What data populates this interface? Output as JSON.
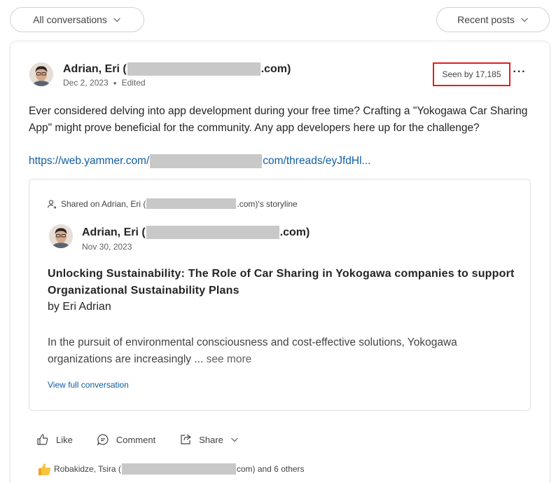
{
  "filters": {
    "left_label": "All conversations",
    "right_label": "Recent posts"
  },
  "post": {
    "author_prefix": "Adrian, Eri (",
    "author_suffix": ".com)",
    "date": "Dec 2, 2023",
    "edited": "Edited",
    "seen_by": "Seen by 17,185",
    "more": "···",
    "body": "Ever considered delving into app development during your free time? Crafting a \"Yokogawa Car Sharing App\" might prove beneficial for the community. Any app developers here up for the challenge?",
    "link_prefix": "https://web.yammer.com/",
    "link_suffix": "com/threads/eyJfdHl..."
  },
  "shared": {
    "head_prefix": "Shared on Adrian, Eri (",
    "head_suffix": ".com)'s storyline",
    "author_prefix": "Adrian, Eri (",
    "author_suffix": ".com)",
    "date": "Nov 30, 2023",
    "title": "Unlocking Sustainability: The Role of Car Sharing in Yokogawa companies to support Organizational Sustainability Plans",
    "byline": "by Eri Adrian",
    "excerpt": "In the pursuit of environmental consciousness and cost-effective solutions, Yokogawa organizations are increasingly ...",
    "see_more": "see more",
    "view_full": "View full conversation"
  },
  "actions": {
    "like": "Like",
    "comment": "Comment",
    "share": "Share"
  },
  "reactions": {
    "prefix": "Robakidze, Tsira (",
    "suffix": "com) and 6 others"
  },
  "colors": {
    "link": "#115ea3",
    "highlight_box": "#e02020",
    "redaction": "#c8c8c8"
  }
}
